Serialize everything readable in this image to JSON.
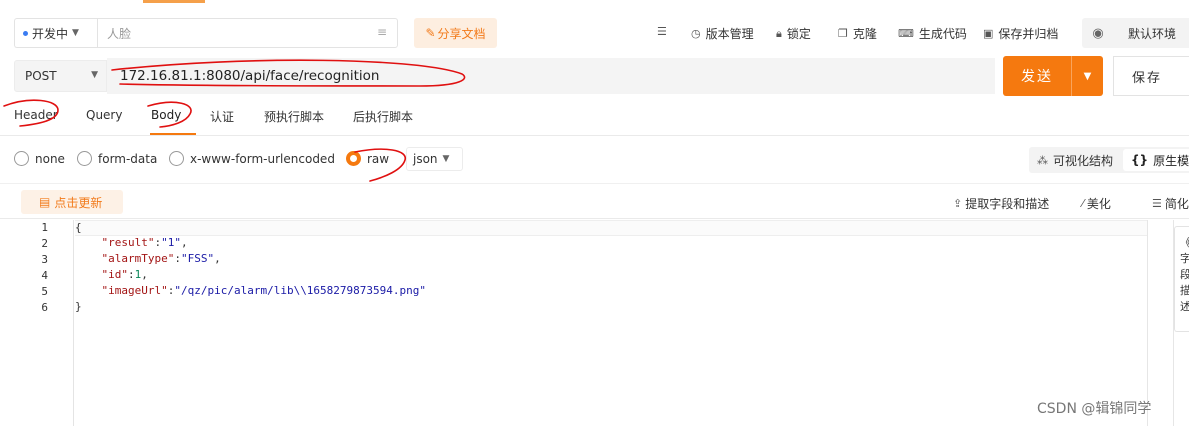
{
  "header": {
    "env_label": "开发中",
    "name_placeholder": "人脸",
    "share_label": "分享文档",
    "toolbar": [
      {
        "label": "版本管理",
        "icon": "clock-icon"
      },
      {
        "label": "锁定",
        "icon": "lock-icon"
      },
      {
        "label": "克隆",
        "icon": "copy-icon"
      },
      {
        "label": "生成代码",
        "icon": "code-icon"
      },
      {
        "label": "保存并归档",
        "icon": "archive-icon"
      }
    ],
    "environment": "默认环境"
  },
  "request": {
    "method": "POST",
    "url": "172.16.81.1:8080/api/face/recognition",
    "send_label": "发送",
    "save_label": "保存"
  },
  "tabs": [
    {
      "label": "Header"
    },
    {
      "label": "Query"
    },
    {
      "label": "Body",
      "active": true
    },
    {
      "label": "认证"
    },
    {
      "label": "预执行脚本"
    },
    {
      "label": "后执行脚本"
    }
  ],
  "body_types": [
    {
      "label": "none",
      "selected": false
    },
    {
      "label": "form-data",
      "selected": false
    },
    {
      "label": "x-www-form-urlencoded",
      "selected": false
    },
    {
      "label": "raw",
      "selected": true
    }
  ],
  "raw_format": "json",
  "view_toggle": {
    "visual": "可视化结构",
    "raw": "原生模式"
  },
  "editor_toolbar": {
    "update": "点击更新",
    "extract": "提取字段和描述",
    "beautify": "美化",
    "simplify": "简化"
  },
  "code_lines": [
    {
      "n": "1",
      "text": "{"
    },
    {
      "n": "2",
      "key": "\"result\"",
      "val": "\"1\"",
      "comma": ","
    },
    {
      "n": "3",
      "key": "\"alarmType\"",
      "val": "\"FSS\"",
      "comma": ","
    },
    {
      "n": "4",
      "key": "\"id\"",
      "num": "1",
      "comma": ","
    },
    {
      "n": "5",
      "key": "\"imageUrl\"",
      "val": "\"/qz/pic/alarm/lib\\\\1658279873594.png\"",
      "comma": ""
    },
    {
      "n": "6",
      "text": "}"
    }
  ],
  "side_panel": [
    "《",
    "字",
    "段",
    "描",
    "述"
  ],
  "watermark": "CSDN @辑锦同学",
  "colors": {
    "accent": "#f5790f",
    "annotation": "#e01010"
  }
}
